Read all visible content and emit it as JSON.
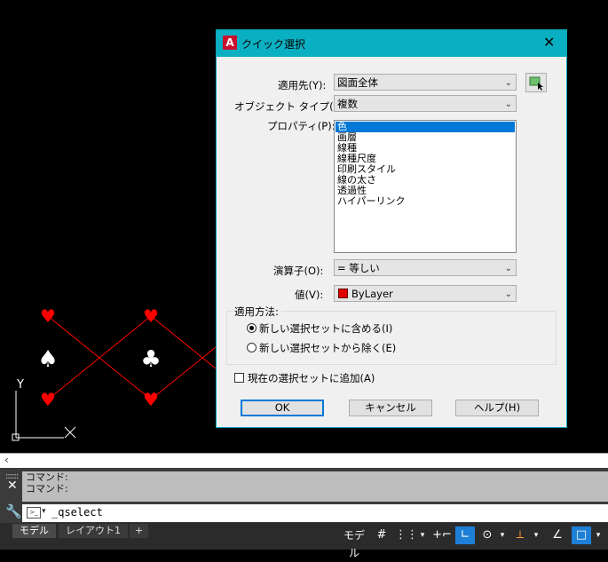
{
  "dialog": {
    "title": "クイック選択",
    "apply_to_label": "適用先(Y):",
    "apply_to_value": "図面全体",
    "object_type_label": "オブジェクト タイプ(B):",
    "object_type_value": "複数",
    "properties_label": "プロパティ(P):",
    "properties": [
      "色",
      "画層",
      "線種",
      "線種尺度",
      "印刷スタイル",
      "線の太さ",
      "透過性",
      "ハイパーリンク"
    ],
    "selected_property": "色",
    "operator_label": "演算子(O):",
    "operator_value": "= 等しい",
    "value_label": "値(V):",
    "value_value": "ByLayer",
    "value_color": "#e00000",
    "how_to_apply_label": "適用方法:",
    "include_option": "新しい選択セットに含める(I)",
    "exclude_option": "新しい選択セットから除く(E)",
    "append_label": "現在の選択セットに追加(A)",
    "ok_label": "OK",
    "cancel_label": "キャンセル",
    "help_label": "ヘルプ(H)"
  },
  "drawing": {
    "symbols": [
      "♥",
      "♥",
      "♠",
      "♣",
      "♥",
      "♥"
    ],
    "ucs_y": "Y",
    "line_color": "#ff0000"
  },
  "command": {
    "history": [
      "コマンド:",
      "コマンド:"
    ],
    "input": "_qselect"
  },
  "tabs": {
    "model": "モデル",
    "layout": "レイアウト1",
    "add": "+"
  },
  "status": {
    "model_label": "モデル",
    "grid_icon": "grid-icon",
    "snap_icon": "snap-icon"
  }
}
